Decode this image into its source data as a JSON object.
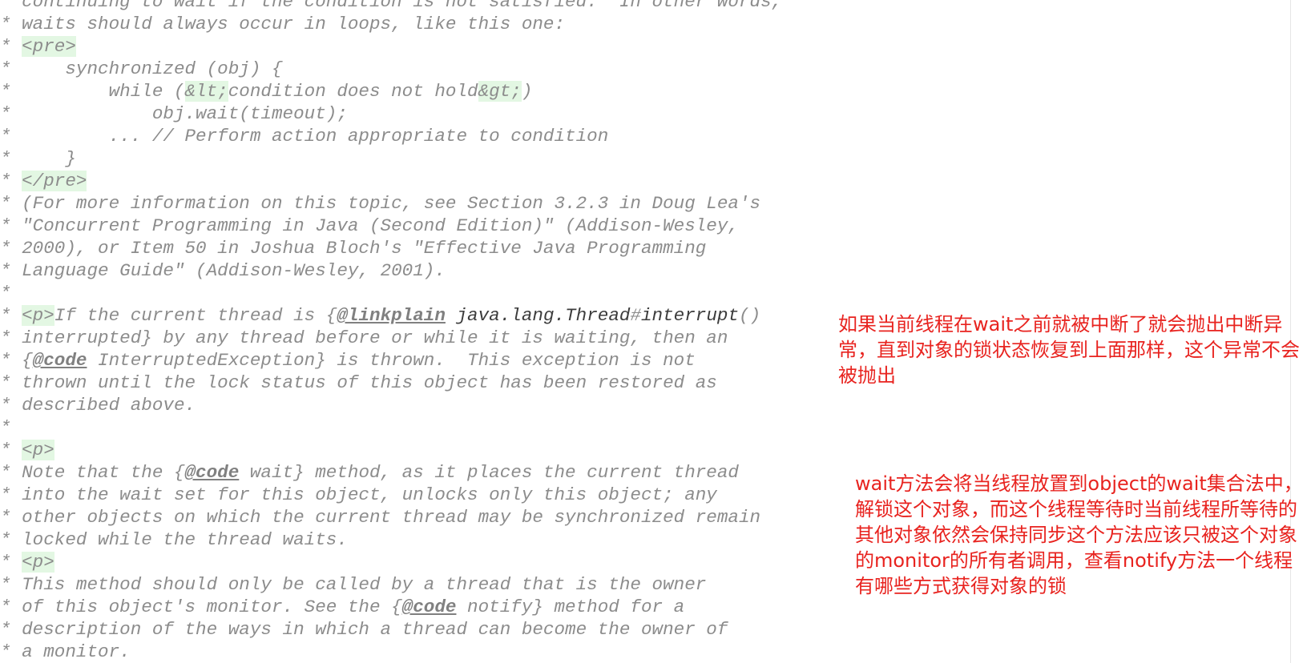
{
  "code": {
    "lines": [
      "continuing to wait if the condition is not satisfied.  In other words,",
      "waits should always occur in loops, like this one:",
      "<pre>",
      "    synchronized (obj) {",
      "        while (&lt;condition does not hold&gt;)",
      "            obj.wait(timeout);",
      "        ... // Perform action appropriate to condition",
      "    }",
      "</pre>",
      "(For more information on this topic, see Section 3.2.3 in Doug Lea's",
      "\"Concurrent Programming in Java (Second Edition)\" (Addison-Wesley,",
      "2000), or Item 50 in Joshua Bloch's \"Effective Java Programming",
      "Language Guide\" (Addison-Wesley, 2001).",
      "",
      "<p>If the current thread is {@linkplain java.lang.Thread#interrupt()",
      "interrupted} by any thread before or while it is waiting, then an",
      "{@code InterruptedException} is thrown.  This exception is not",
      "thrown until the lock status of this object has been restored as",
      "described above.",
      "",
      "<p>",
      "Note that the {@code wait} method, as it places the current thread",
      "into the wait set for this object, unlocks only this object; any",
      "other objects on which the current thread may be synchronized remain",
      "locked while the thread waits.",
      "<p>",
      "This method should only be called by a thread that is the owner",
      "of this object's monitor. See the {@code notify} method for a",
      "description of the ways in which a thread can become the owner of",
      "a monitor."
    ]
  },
  "annotations": {
    "note1": "如果当前线程在wait之前就被中断了就会抛出中断异\n常，直到对象的锁状态恢复到上面那样，这个异常不会\n被抛出",
    "note2": "wait方法会将当线程放置到object的wait集合法中，\n解锁这个对象，而这个线程等待时当前线程所等待的\n其他对象依然会保持同步这个方法应该只被这个对象\n的monitor的所有者调用，查看notify方法一个线程\n有哪些方式获得对象的锁",
    "color": "#e8231f"
  }
}
